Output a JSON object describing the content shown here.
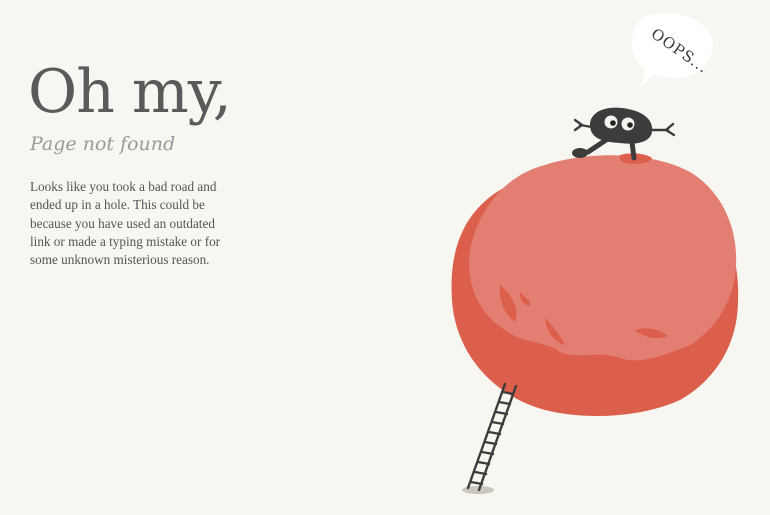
{
  "error": {
    "headline": "Oh my,",
    "subtitle": "Page not found",
    "message_lines": [
      "Looks like you took a bad road and",
      "ended up in a hole.  This could be",
      "because you have used an outdated",
      "link or made a typing mistake or for",
      "some unknown misterious reason."
    ]
  },
  "illustration": {
    "speech_bubble_text": "OOPS...",
    "colors": {
      "background": "#f8f6f1",
      "planet": "#e37f72",
      "planet_shadow": "#dc5f4c",
      "creature": "#3c3c3c",
      "ladder": "#3c3c3c",
      "ladder_shadow": "#c9c6bd"
    }
  }
}
